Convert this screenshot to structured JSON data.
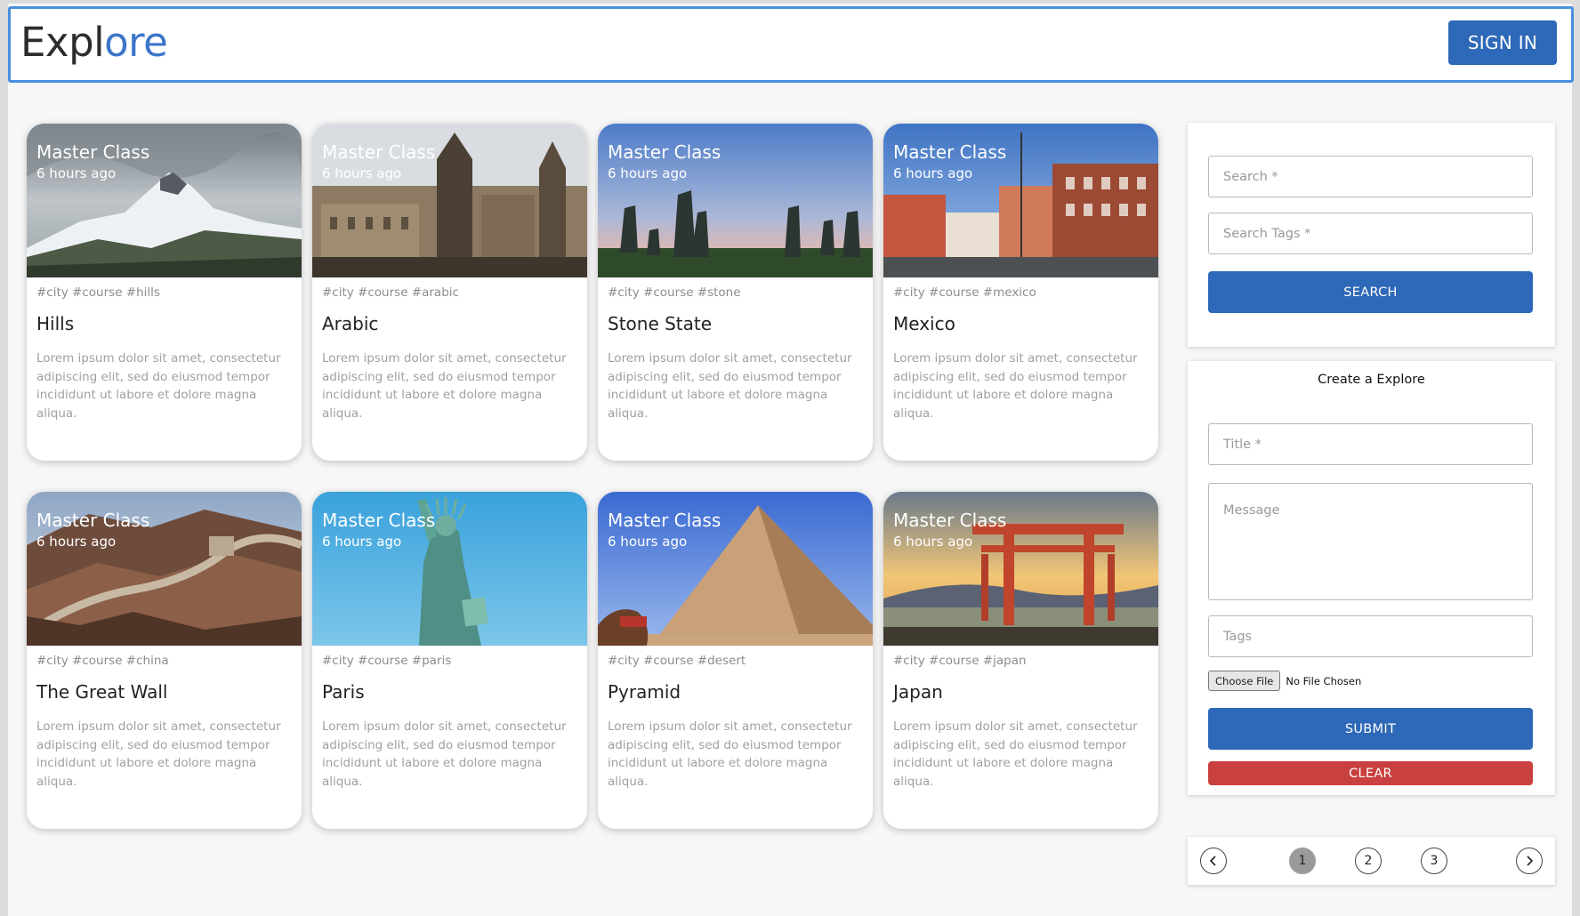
{
  "header": {
    "brand_part1": "Expl",
    "brand_part2": "ore",
    "sign_in_label": "SIGN IN"
  },
  "cards": [
    {
      "overlay_title": "Master Class",
      "time": "6 hours ago",
      "tags": "#city #course #hills",
      "title": "Hills",
      "description": "Lorem ipsum dolor sit amet, consectetur adipiscing elit, sed do eiusmod tempor incididunt ut labore et dolore magna aliqua.",
      "image": "snowy-mountain"
    },
    {
      "overlay_title": "Master Class",
      "time": "6 hours ago",
      "tags": "#city #course #arabic",
      "title": "Arabic",
      "description": "Lorem ipsum dolor sit amet, consectetur adipiscing elit, sed do eiusmod tempor incididunt ut labore et dolore magna aliqua.",
      "image": "old-cathedral-city"
    },
    {
      "overlay_title": "Master Class",
      "time": "6 hours ago",
      "tags": "#city #course #stone",
      "title": "Stone State",
      "description": "Lorem ipsum dolor sit amet, consectetur adipiscing elit, sed do eiusmod tempor incididunt ut labore et dolore magna aliqua.",
      "image": "standing-stones"
    },
    {
      "overlay_title": "Master Class",
      "time": "6 hours ago",
      "tags": "#city #course #mexico",
      "title": "Mexico",
      "description": "Lorem ipsum dolor sit amet, consectetur adipiscing elit, sed do eiusmod tempor incididunt ut labore et dolore magna aliqua.",
      "image": "harbor-houses"
    },
    {
      "overlay_title": "Master Class",
      "time": "6 hours ago",
      "tags": "#city #course #china",
      "title": "The Great Wall",
      "description": "Lorem ipsum dolor sit amet, consectetur adipiscing elit, sed do eiusmod tempor incididunt ut labore et dolore magna aliqua.",
      "image": "great-wall"
    },
    {
      "overlay_title": "Master Class",
      "time": "6 hours ago",
      "tags": "#city #course #paris",
      "title": "Paris",
      "description": "Lorem ipsum dolor sit amet, consectetur adipiscing elit, sed do eiusmod tempor incididunt ut labore et dolore magna aliqua.",
      "image": "statue-of-liberty"
    },
    {
      "overlay_title": "Master Class",
      "time": "6 hours ago",
      "tags": "#city #course #desert",
      "title": "Pyramid",
      "description": "Lorem ipsum dolor sit amet, consectetur adipiscing elit, sed do eiusmod tempor incididunt ut labore et dolore magna aliqua.",
      "image": "pyramid"
    },
    {
      "overlay_title": "Master Class",
      "time": "6 hours ago",
      "tags": "#city #course #japan",
      "title": "Japan",
      "description": "Lorem ipsum dolor sit amet, consectetur adipiscing elit, sed do eiusmod tempor incididunt ut labore et dolore magna aliqua.",
      "image": "torii-gate"
    }
  ],
  "search_panel": {
    "search_placeholder": "Search *",
    "tags_placeholder": "Search Tags *",
    "search_button": "SEARCH"
  },
  "create_panel": {
    "heading": "Create a Explore",
    "title_placeholder": "Title *",
    "message_placeholder": "Message",
    "tags_placeholder": "Tags",
    "choose_file_label": "Choose File",
    "no_file_label": "No File Chosen",
    "submit_button": "SUBMIT",
    "clear_button": "CLEAR"
  },
  "pagination": {
    "pages": [
      "1",
      "2",
      "3"
    ],
    "current_page": "1",
    "prev_icon": "chevron-left-icon",
    "next_icon": "chevron-right-icon"
  },
  "colors": {
    "primary": "#2e68b8",
    "brand_accent": "#3b76c9",
    "danger": "#c94040",
    "header_border": "#4a8fe0"
  }
}
